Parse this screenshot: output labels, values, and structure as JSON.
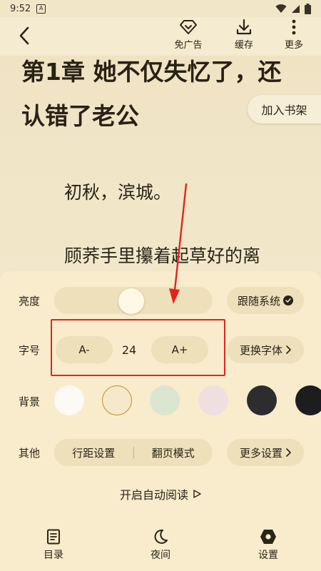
{
  "status": {
    "time": "9:52",
    "notif_letter": "A"
  },
  "topbar": {
    "no_ads_label": "免广告",
    "cache_label": "缓存",
    "more_label": "更多"
  },
  "reader": {
    "chapter_title_line1": "第1章 她不仅失忆了，还",
    "chapter_title_line2": "认错了老公",
    "add_bookshelf": "加入书架",
    "paragraphs": [
      "初秋，滨城。",
      "顾荞手里攥着起草好的离"
    ]
  },
  "settings": {
    "brightness_label": "亮度",
    "brightness_level": 0.5,
    "follow_system_label": "跟随系统",
    "font_label": "字号",
    "font_decrease": "A-",
    "font_size": "24",
    "font_increase": "A+",
    "change_font_label": "更换字体",
    "background_label": "背景",
    "backgrounds": [
      "#fdfaf5",
      "#f5e8cb",
      "#dbe5d0",
      "#efdfdf",
      "#2d2d2f",
      "#1d1d1f"
    ],
    "selected_background": 1,
    "other_label": "其他",
    "line_spacing_label": "行距设置",
    "page_mode_label": "翻页模式",
    "more_settings_label": "更多设置",
    "auto_read_label": "开启自动阅读"
  },
  "bottom_nav": {
    "toc_label": "目录",
    "night_label": "夜间",
    "settings_label": "设置"
  },
  "colors": {
    "highlight_box": "#e0261c",
    "panel_bg": "#f8eccd",
    "page_bg": "#f1e6c8"
  }
}
